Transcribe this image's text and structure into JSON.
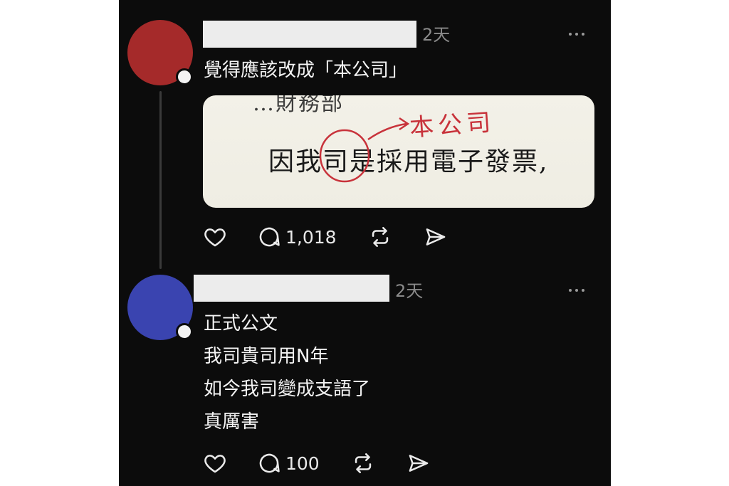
{
  "posts": [
    {
      "time": "2天",
      "avatar_color": "#a52a2a",
      "text_lines": [
        "覺得應該改成「本公司」"
      ],
      "image": {
        "cut_text": "…財務部",
        "printed_text": "因我司是採用電子發票,",
        "handwritten_text": "本公司"
      },
      "reply_count": "1,018"
    },
    {
      "time": "2天",
      "avatar_color": "#3a44b0",
      "text_lines": [
        "正式公文",
        "我司貴司用N年",
        "如今我司變成支語了",
        "真厲害"
      ],
      "reply_count": "100"
    }
  ],
  "icons": {
    "like": "heart-icon",
    "reply": "comment-icon",
    "repost": "repost-icon",
    "share": "send-icon",
    "more": "more-dots-icon"
  }
}
